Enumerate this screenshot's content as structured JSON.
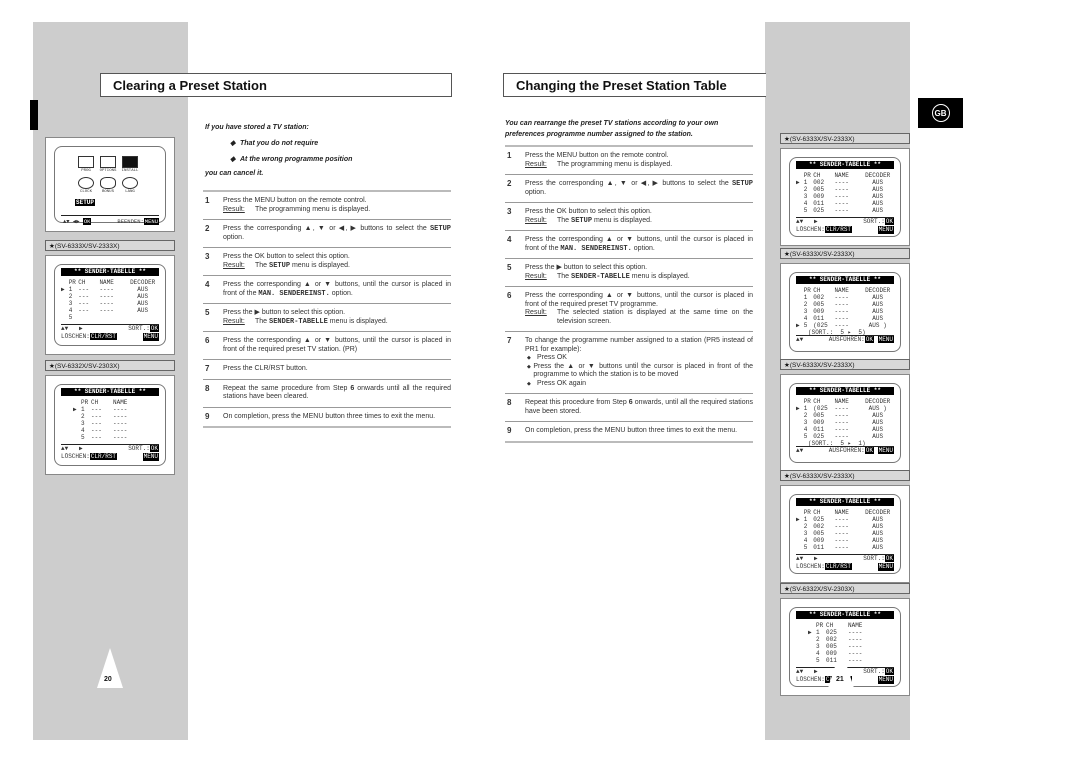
{
  "left_page": {
    "title": "Clearing a Preset Station",
    "page_number": "20",
    "intro": {
      "lead": "If you have stored a TV station:",
      "bullets": [
        "That you do not require",
        "At the wrong programme position"
      ],
      "tail": "you can cancel it."
    },
    "steps": [
      {
        "num": "1",
        "text": "Press the MENU button on the remote control.",
        "result_label": "Result:",
        "result": "The programming menu is displayed."
      },
      {
        "num": "2",
        "text_a": "Press the corresponding ▲, ▼ or ◀, ▶ buttons to select the ",
        "bold": "SETUP",
        "text_b": " option."
      },
      {
        "num": "3",
        "text": "Press the OK button to select this option.",
        "result_label": "Result:",
        "result_a": "The ",
        "result_bold": "SETUP",
        "result_b": " menu is displayed."
      },
      {
        "num": "4",
        "text_a": "Press the corresponding ▲ or ▼ buttons, until the cursor is placed in front of the ",
        "bold": "MAN. SENDEREINST.",
        "text_b": " option."
      },
      {
        "num": "5",
        "text": "Press the ▶ button to select this option.",
        "result_label": "Result:",
        "result_a": "The ",
        "result_bold": "SENDER-TABELLE",
        "result_b": " menu is displayed."
      },
      {
        "num": "6",
        "text": "Press the corresponding ▲ or ▼ buttons, until the cursor is placed in front of the required preset TV station. (PR)"
      },
      {
        "num": "7",
        "text": "Press the CLR/RST button."
      },
      {
        "num": "8",
        "text_a": "Repeat the same procedure from Step ",
        "bold": "6",
        "text_b": " onwards until all the required stations have been cleared."
      },
      {
        "num": "9",
        "text": "On completion, press the MENU button three times to exit the menu."
      }
    ],
    "setup_menu": {
      "icons": [
        "PROG",
        "OPTIONS",
        "INSTALL",
        "CLOCK",
        "BONUS",
        "LANG"
      ],
      "selected": "SETUP",
      "footer_nav": "▲▼ ◀▶",
      "footer_ok": "OK",
      "footer_exit": "BEENDEN:",
      "footer_menu": "MENU"
    },
    "screens": [
      {
        "model": "★(SV-6333X/SV-2333X)",
        "title": "** SENDER-TABELLE **",
        "headers": [
          "PR",
          "CH",
          "NAME",
          "DECODER"
        ],
        "rows": [
          {
            "cur": "▶",
            "pr": "1",
            "ch": "---",
            "name": "----",
            "dec": "AUS"
          },
          {
            "cur": "",
            "pr": "2",
            "ch": "---",
            "name": "----",
            "dec": "AUS"
          },
          {
            "cur": "",
            "pr": "3",
            "ch": "---",
            "name": "----",
            "dec": "AUS"
          },
          {
            "cur": "",
            "pr": "4",
            "ch": "---",
            "name": "----",
            "dec": "AUS"
          },
          {
            "cur": "",
            "pr": "5",
            "ch": "",
            "name": "",
            "dec": ""
          }
        ],
        "foot1_left": "▲▼   ▶",
        "foot1_right": "SORT.:",
        "foot1_key": "OK",
        "foot2_left": "LÖSCHEN:",
        "foot2_key": "CLR/RST",
        "foot2_menu": "MENU"
      },
      {
        "model": "★(SV-6332X/SV-2303X)",
        "title": "** SENDER-TABELLE **",
        "headers": [
          "PR",
          "CH",
          "NAME"
        ],
        "rows": [
          {
            "cur": "▶",
            "pr": "1",
            "ch": "---",
            "name": "----"
          },
          {
            "cur": "",
            "pr": "2",
            "ch": "---",
            "name": "----"
          },
          {
            "cur": "",
            "pr": "3",
            "ch": "---",
            "name": "----"
          },
          {
            "cur": "",
            "pr": "4",
            "ch": "---",
            "name": "----"
          },
          {
            "cur": "",
            "pr": "5",
            "ch": "---",
            "name": "----"
          }
        ],
        "foot1_left": "▲▼   ▶",
        "foot1_right": "SORT.:",
        "foot1_key": "OK",
        "foot2_left": "LÖSCHEN:",
        "foot2_key": "CLR/RST",
        "foot2_menu": "MENU"
      }
    ]
  },
  "right_page": {
    "title": "Changing the Preset Station Table",
    "page_number": "21",
    "language_badge": "GB",
    "intro": "You can rearrange the preset TV stations according to your own preferences programme number assigned to the station.",
    "steps": [
      {
        "num": "1",
        "text": "Press the MENU button on the remote control.",
        "result_label": "Result:",
        "result": "The programming menu is displayed."
      },
      {
        "num": "2",
        "text_a": "Press the corresponding ▲, ▼ or ◀, ▶ buttons to select the ",
        "bold": "SETUP",
        "text_b": " option."
      },
      {
        "num": "3",
        "text": "Press the OK button to select this option.",
        "result_label": "Result:",
        "result_a": "The ",
        "result_bold": "SETUP",
        "result_b": " menu is displayed."
      },
      {
        "num": "4",
        "text_a": "Press the corresponding ▲ or ▼ buttons, until the cursor is placed in front of the ",
        "bold": "MAN. SENDEREINST.",
        "text_b": " option."
      },
      {
        "num": "5",
        "text": "Press the ▶ button to select this option.",
        "result_label": "Result:",
        "result_a": "The ",
        "result_bold": "SENDER-TABELLE",
        "result_b": " menu is displayed."
      },
      {
        "num": "6",
        "text": "Press the corresponding ▲ or ▼ buttons, until the cursor is placed in front of the required preset TV programme.",
        "result_label": "Result:",
        "result": "The selected station is displayed at the same time on the television screen."
      },
      {
        "num": "7",
        "text": "To change the programme number assigned to a station (PR5 instead of PR1 for example):",
        "bullets": [
          "Press OK",
          "Press the ▲ or ▼ buttons until the cursor is placed in front of the programme to which the station is to be moved",
          "Press OK again"
        ]
      },
      {
        "num": "8",
        "text_a": "Repeat this procedure from Step ",
        "bold": "6",
        "text_b": " onwards, until all the required stations have been stored."
      },
      {
        "num": "9",
        "text": "On completion, press the MENU button three times to exit the menu."
      }
    ],
    "screens": [
      {
        "model": "★(SV-6333X/SV-2333X)",
        "title": "** SENDER-TABELLE **",
        "headers": [
          "PR",
          "CH",
          "NAME",
          "DECODER"
        ],
        "rows": [
          {
            "cur": "▶",
            "pr": "1",
            "ch": "002",
            "name": "----",
            "dec": "AUS"
          },
          {
            "cur": "",
            "pr": "2",
            "ch": "005",
            "name": "----",
            "dec": "AUS"
          },
          {
            "cur": "",
            "pr": "3",
            "ch": "009",
            "name": "----",
            "dec": "AUS"
          },
          {
            "cur": "",
            "pr": "4",
            "ch": "011",
            "name": "----",
            "dec": "AUS"
          },
          {
            "cur": "",
            "pr": "5",
            "ch": "025",
            "name": "----",
            "dec": "AUS"
          }
        ],
        "foot1_left": "▲▼   ▶",
        "foot1_right": "SORT.:",
        "foot1_key": "OK",
        "foot2_left": "LÖSCHEN:",
        "foot2_key": "CLR/RST",
        "foot2_menu": "MENU"
      },
      {
        "model": "★(SV-6333X/SV-2333X)",
        "title": "** SENDER-TABELLE **",
        "headers": [
          "PR",
          "CH",
          "NAME",
          "DECODER"
        ],
        "rows": [
          {
            "cur": "",
            "pr": "1",
            "ch": "002",
            "name": "----",
            "dec": "AUS"
          },
          {
            "cur": "",
            "pr": "2",
            "ch": "005",
            "name": "----",
            "dec": "AUS"
          },
          {
            "cur": "",
            "pr": "3",
            "ch": "009",
            "name": "----",
            "dec": "AUS"
          },
          {
            "cur": "",
            "pr": "4",
            "ch": "011",
            "name": "----",
            "dec": "AUS"
          },
          {
            "cur": "▶",
            "pr": "5",
            "ch": "(025",
            "name": "----",
            "dec": "AUS )"
          }
        ],
        "sort_line": "(SORT.:  5 ▸  5)",
        "foot_alt_left": "▲▼",
        "foot_alt_label": "AUSFÜHREN:",
        "foot_alt_key": "OK",
        "foot_alt_menu": "MENU"
      },
      {
        "model": "★(SV-6333X/SV-2333X)",
        "title": "** SENDER-TABELLE **",
        "headers": [
          "PR",
          "CH",
          "NAME",
          "DECODER"
        ],
        "rows": [
          {
            "cur": "▶",
            "pr": "1",
            "ch": "(025",
            "name": "----",
            "dec": "AUS )"
          },
          {
            "cur": "",
            "pr": "2",
            "ch": "005",
            "name": "----",
            "dec": "AUS"
          },
          {
            "cur": "",
            "pr": "3",
            "ch": "009",
            "name": "----",
            "dec": "AUS"
          },
          {
            "cur": "",
            "pr": "4",
            "ch": "011",
            "name": "----",
            "dec": "AUS"
          },
          {
            "cur": "",
            "pr": "5",
            "ch": "025",
            "name": "----",
            "dec": "AUS"
          }
        ],
        "sort_line": "(SORT.:  5 ▸  1)",
        "foot_alt_left": "▲▼",
        "foot_alt_label": "AUSFÜHREN:",
        "foot_alt_key": "OK",
        "foot_alt_menu": "MENU"
      },
      {
        "model": "★(SV-6333X/SV-2333X)",
        "title": "** SENDER-TABELLE **",
        "headers": [
          "PR",
          "CH",
          "NAME",
          "DECODER"
        ],
        "rows": [
          {
            "cur": "▶",
            "pr": "1",
            "ch": "025",
            "name": "----",
            "dec": "AUS"
          },
          {
            "cur": "",
            "pr": "2",
            "ch": "002",
            "name": "----",
            "dec": "AUS"
          },
          {
            "cur": "",
            "pr": "3",
            "ch": "005",
            "name": "----",
            "dec": "AUS"
          },
          {
            "cur": "",
            "pr": "4",
            "ch": "009",
            "name": "----",
            "dec": "AUS"
          },
          {
            "cur": "",
            "pr": "5",
            "ch": "011",
            "name": "----",
            "dec": "AUS"
          }
        ],
        "foot1_left": "▲▼   ▶",
        "foot1_right": "SORT.:",
        "foot1_key": "OK",
        "foot2_left": "LÖSCHEN:",
        "foot2_key": "CLR/RST",
        "foot2_menu": "MENU"
      },
      {
        "model": "★(SV-6332X/SV-2303X)",
        "title": "** SENDER-TABELLE **",
        "headers": [
          "PR",
          "CH",
          "NAME"
        ],
        "rows": [
          {
            "cur": "▶",
            "pr": "1",
            "ch": "025",
            "name": "----"
          },
          {
            "cur": "",
            "pr": "2",
            "ch": "002",
            "name": "----"
          },
          {
            "cur": "",
            "pr": "3",
            "ch": "005",
            "name": "----"
          },
          {
            "cur": "",
            "pr": "4",
            "ch": "009",
            "name": "----"
          },
          {
            "cur": "",
            "pr": "5",
            "ch": "011",
            "name": "----"
          }
        ],
        "foot1_left": "▲▼   ▶",
        "foot1_right": "SORT.:",
        "foot1_key": "OK",
        "foot2_left": "LÖSCHEN:",
        "foot2_key": "CLR/RST",
        "foot2_menu": "MENU"
      }
    ]
  }
}
